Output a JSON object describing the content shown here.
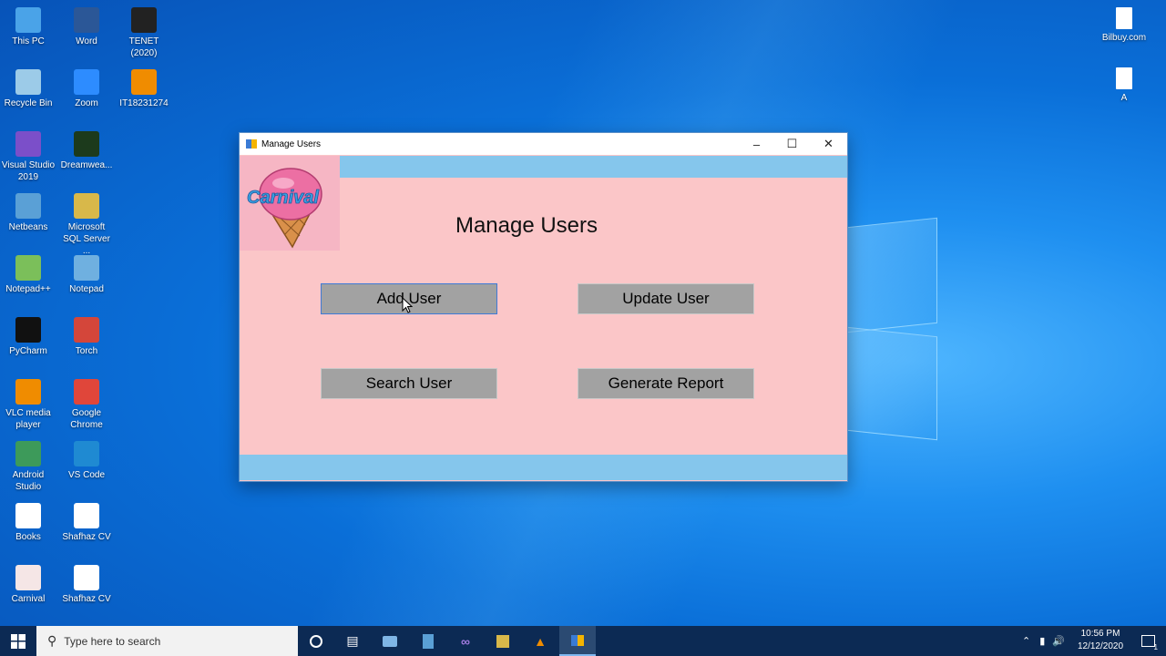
{
  "desktop": {
    "icons": [
      {
        "label": "This PC",
        "icon": "computer-icon",
        "color": "#4aa3e8"
      },
      {
        "label": "Word",
        "icon": "word-icon",
        "color": "#2b5797"
      },
      {
        "label": "TENET (2020)",
        "icon": "video-file-icon",
        "color": "#222222"
      },
      {
        "label": "Recycle Bin",
        "icon": "recycle-bin-icon",
        "color": "#9ccbe8"
      },
      {
        "label": "Zoom",
        "icon": "zoom-icon",
        "color": "#2d8cff"
      },
      {
        "label": "IT18231274",
        "icon": "vlc-icon",
        "color": "#f08c00"
      },
      {
        "label": "Visual Studio 2019",
        "icon": "visual-studio-icon",
        "color": "#7b4fc9"
      },
      {
        "label": "Dreamwea...",
        "icon": "dreamweaver-icon",
        "color": "#1c3a1c"
      },
      {
        "label": "Netbeans",
        "icon": "netbeans-icon",
        "color": "#5aa0d6"
      },
      {
        "label": "Microsoft SQL Server ...",
        "icon": "sql-server-icon",
        "color": "#d8b84a"
      },
      {
        "label": "Notepad++",
        "icon": "notepadpp-icon",
        "color": "#7bbf5a"
      },
      {
        "label": "Notepad",
        "icon": "notepad-icon",
        "color": "#6fb0e0"
      },
      {
        "label": "PyCharm",
        "icon": "pycharm-icon",
        "color": "#111111"
      },
      {
        "label": "Torch",
        "icon": "torch-icon",
        "color": "#d4463a"
      },
      {
        "label": "VLC media player",
        "icon": "vlc-icon",
        "color": "#f08c00"
      },
      {
        "label": "Google Chrome",
        "icon": "chrome-icon",
        "color": "#e0463a"
      },
      {
        "label": "Android Studio",
        "icon": "android-studio-icon",
        "color": "#3d9a5a"
      },
      {
        "label": "VS Code",
        "icon": "vscode-icon",
        "color": "#1f8ad2"
      },
      {
        "label": "Books",
        "icon": "pdf-icon",
        "color": "#ffffff"
      },
      {
        "label": "Shafhaz CV",
        "icon": "word-doc-icon",
        "color": "#ffffff"
      },
      {
        "label": "Carnival",
        "icon": "carnival-icon",
        "color": "#f5e6e6"
      },
      {
        "label": "Shafhaz CV",
        "icon": "pdf-icon",
        "color": "#ffffff"
      }
    ],
    "right_icons": [
      {
        "label": "Bilbuy.com",
        "icon": "file-icon"
      },
      {
        "label": "A",
        "icon": "file-icon"
      }
    ]
  },
  "window": {
    "title": "Manage Users",
    "minimize": "–",
    "maximize": "☐",
    "close": "✕",
    "logo_text": "Carnival",
    "heading": "Manage Users",
    "buttons": {
      "add": "Add User",
      "update": "Update User",
      "search": "Search User",
      "report": "Generate Report"
    },
    "accent": "#85c6ec",
    "background": "#fbc6c8"
  },
  "taskbar": {
    "search_placeholder": "Type here to search",
    "time": "10:56 PM",
    "date": "12/12/2020",
    "notification_count": "1"
  }
}
